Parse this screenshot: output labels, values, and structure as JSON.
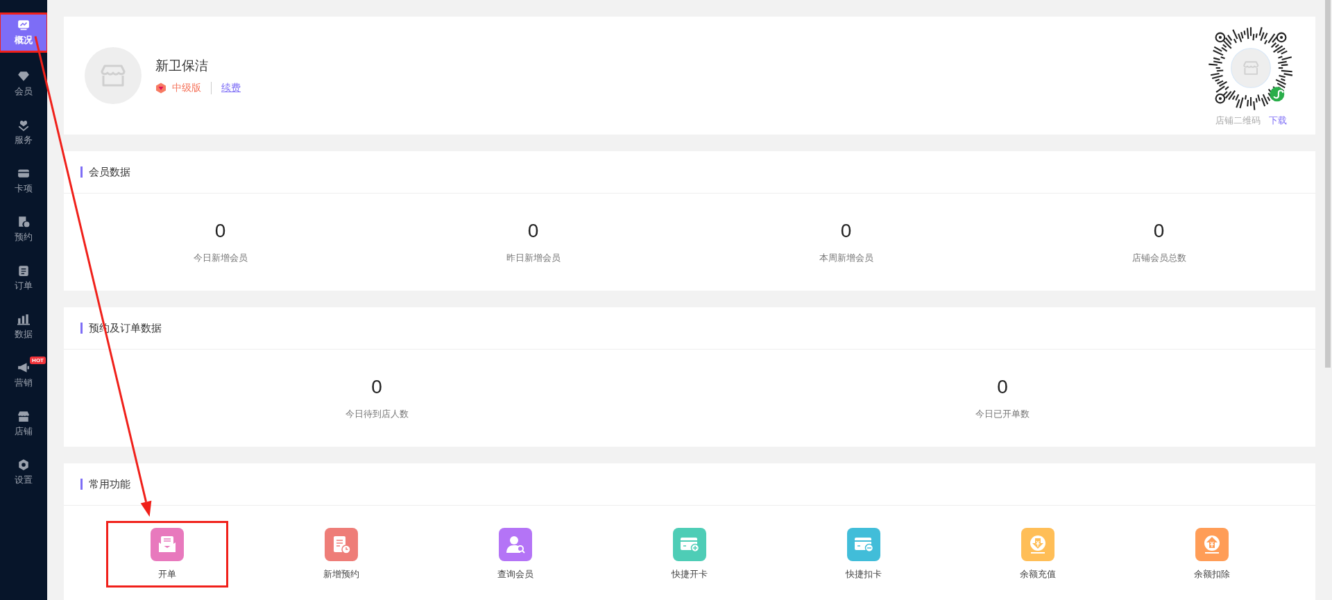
{
  "sidebar": {
    "items": [
      {
        "label": "概况",
        "selected": true,
        "highlighted": true
      },
      {
        "label": "会员",
        "selected": false
      },
      {
        "label": "服务",
        "selected": false
      },
      {
        "label": "卡项",
        "selected": false
      },
      {
        "label": "预约",
        "selected": false
      },
      {
        "label": "订单",
        "selected": false
      },
      {
        "label": "数据",
        "selected": false
      },
      {
        "label": "营销",
        "selected": false,
        "badge": "HOT"
      },
      {
        "label": "店铺",
        "selected": false
      },
      {
        "label": "设置",
        "selected": false
      }
    ]
  },
  "shop": {
    "name": "新卫保洁",
    "edition": "中级版",
    "renew_link": "续费",
    "qr_label": "店铺二维码",
    "download_link": "下载"
  },
  "member_data": {
    "title": "会员数据",
    "stats": [
      {
        "value": "0",
        "label": "今日新增会员"
      },
      {
        "value": "0",
        "label": "昨日新增会员"
      },
      {
        "value": "0",
        "label": "本周新增会员"
      },
      {
        "value": "0",
        "label": "店铺会员总数"
      }
    ]
  },
  "booking_order_data": {
    "title": "预约及订单数据",
    "stats": [
      {
        "value": "0",
        "label": "今日待到店人数"
      },
      {
        "value": "0",
        "label": "今日已开单数"
      }
    ]
  },
  "common_functions": {
    "title": "常用功能",
    "items": [
      {
        "label": "开单",
        "color": "#e879bd",
        "highlighted": true
      },
      {
        "label": "新增预约",
        "color": "#ee7d78",
        "highlighted": false
      },
      {
        "label": "查询会员",
        "color": "#b474f6",
        "highlighted": false
      },
      {
        "label": "快捷开卡",
        "color": "#4ecdb6",
        "highlighted": false
      },
      {
        "label": "快捷扣卡",
        "color": "#41bdd9",
        "highlighted": false
      },
      {
        "label": "余额充值",
        "color": "#ffbe57",
        "highlighted": false
      },
      {
        "label": "余额扣除",
        "color": "#ff9d57",
        "highlighted": false
      }
    ]
  },
  "annotation": {
    "arrow": true
  }
}
